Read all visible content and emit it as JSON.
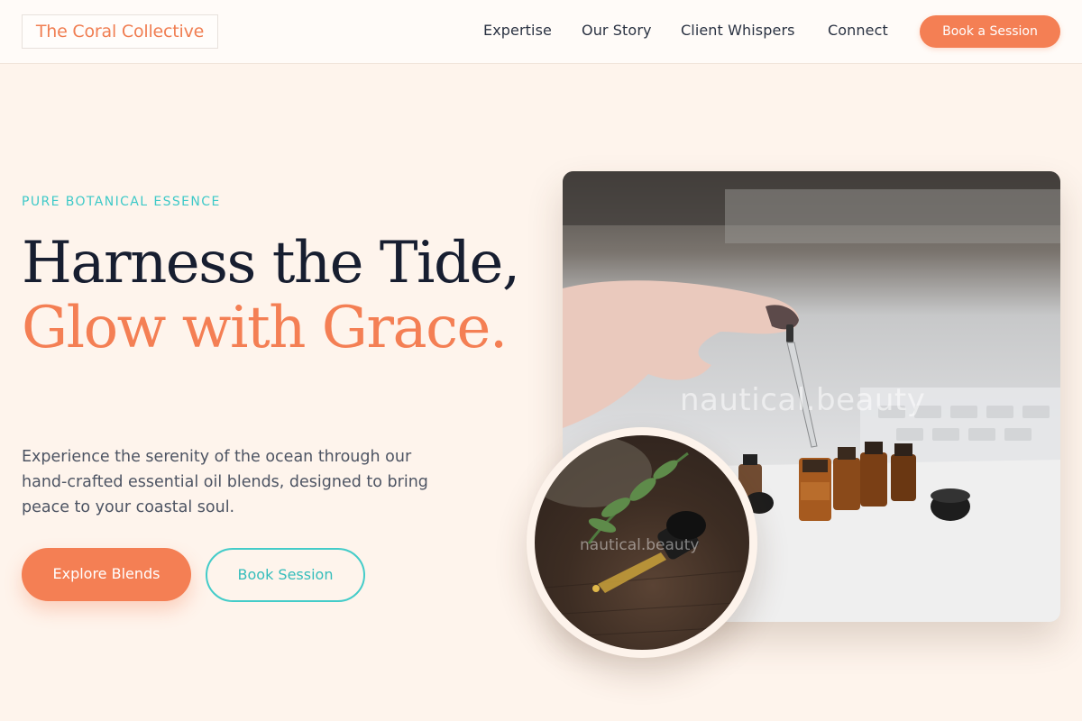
{
  "brand": {
    "name": "The Coral Collective"
  },
  "nav": {
    "links": [
      "Expertise",
      "Our Story",
      "Client Whispers",
      "Connect"
    ],
    "cta_label": "Book a Session"
  },
  "hero": {
    "eyebrow": "PURE BOTANICAL ESSENCE",
    "headline_line1": "Harness the Tide,",
    "headline_line2": "Glow with Grace.",
    "description": "Experience the serenity of the ocean through our hand-crafted essential oil blends, designed to bring peace to your coastal soul.",
    "primary_button": "Explore Blends",
    "secondary_button": "Book Session"
  },
  "images": {
    "main_watermark": "nautical.beauty",
    "circle_watermark": "nautical.beauty"
  },
  "colors": {
    "accent": "#f47f54",
    "teal": "#44ccc9",
    "background": "#fef4ec",
    "heading": "#171e30"
  }
}
